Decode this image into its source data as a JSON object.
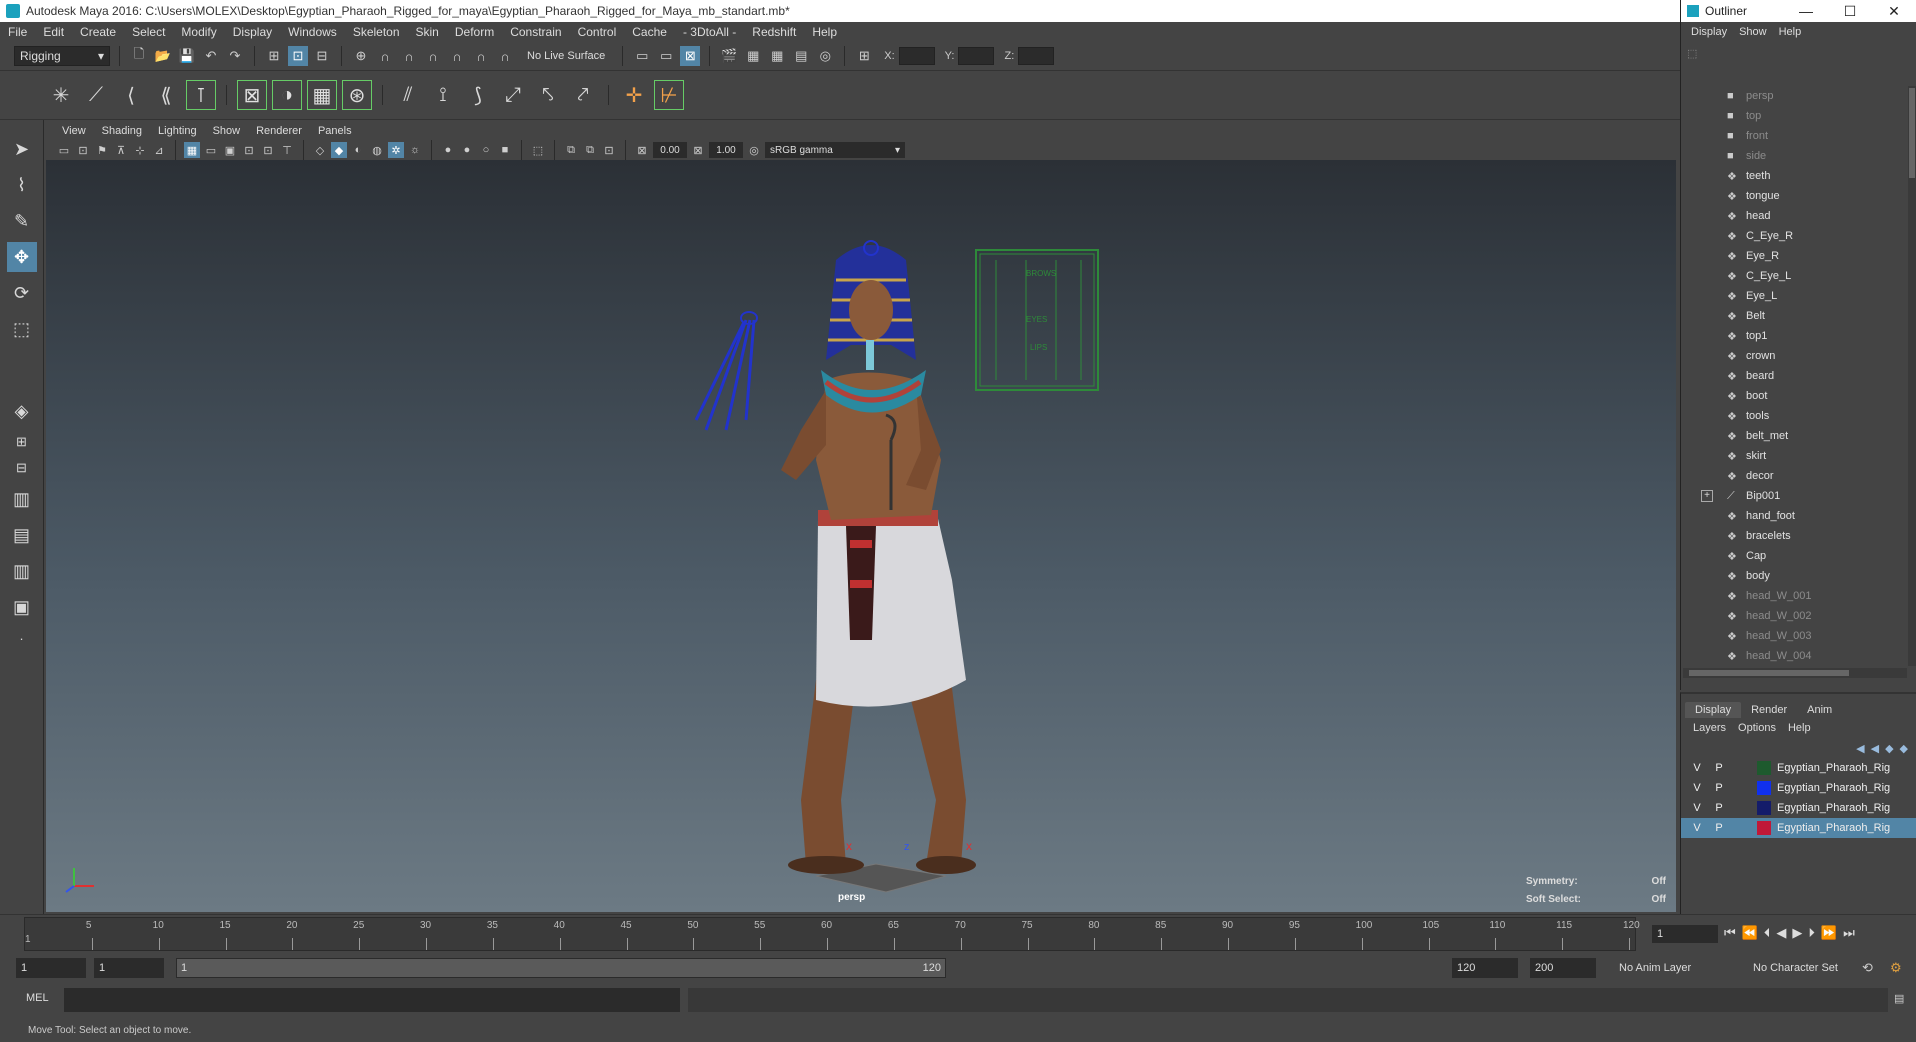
{
  "window": {
    "title": "Autodesk Maya 2016: C:\\Users\\MOLEX\\Desktop\\Egyptian_Pharaoh_Rigged_for_maya\\Egyptian_Pharaoh_Rigged_for_Maya_mb_standart.mb*"
  },
  "menubar": [
    "File",
    "Edit",
    "Create",
    "Select",
    "Modify",
    "Display",
    "Windows",
    "Skeleton",
    "Skin",
    "Deform",
    "Constrain",
    "Control",
    "Cache",
    "- 3DtoAll -",
    "Redshift",
    "Help"
  ],
  "statusline": {
    "menuset": "Rigging",
    "live_surface": "No Live Surface",
    "x_label": "X:",
    "y_label": "Y:",
    "z_label": "Z:"
  },
  "panel_menu": [
    "View",
    "Shading",
    "Lighting",
    "Show",
    "Renderer",
    "Panels"
  ],
  "panel_toolbar": {
    "exposure": "0.00",
    "gamma": "1.00",
    "color_space": "sRGB gamma"
  },
  "viewport": {
    "camera": "persp",
    "hud": {
      "symmetry_label": "Symmetry:",
      "symmetry_value": "Off",
      "soft_select_label": "Soft Select:",
      "soft_select_value": "Off"
    },
    "face_panel_labels": [
      "BROWS",
      "EYES",
      "LIPS"
    ],
    "axis_labels": {
      "x": "x",
      "z": "z"
    },
    "colors": {
      "skin": "#8a5a3a",
      "skirt": "#d8d8dc",
      "headdress_stripe": "#23309a",
      "gold": "#c8a44a",
      "face_panel": "#2e8a3a",
      "wire": "#2233cc",
      "locator": "#e03030"
    }
  },
  "outliner": {
    "title": "Outliner",
    "window_buttons": [
      "—",
      "☐",
      "✕"
    ],
    "menu": [
      "Display",
      "Show",
      "Help"
    ],
    "items": [
      {
        "label": "persp",
        "icon": "camera-icon",
        "dim": true
      },
      {
        "label": "top",
        "icon": "camera-icon",
        "dim": true
      },
      {
        "label": "front",
        "icon": "camera-icon",
        "dim": true
      },
      {
        "label": "side",
        "icon": "camera-icon",
        "dim": true
      },
      {
        "label": "teeth",
        "icon": "mesh-icon",
        "dim": false
      },
      {
        "label": "tongue",
        "icon": "mesh-icon",
        "dim": false
      },
      {
        "label": "head",
        "icon": "mesh-icon",
        "dim": false
      },
      {
        "label": "C_Eye_R",
        "icon": "mesh-icon",
        "dim": false
      },
      {
        "label": "Eye_R",
        "icon": "mesh-icon",
        "dim": false
      },
      {
        "label": "C_Eye_L",
        "icon": "mesh-icon",
        "dim": false
      },
      {
        "label": "Eye_L",
        "icon": "mesh-icon",
        "dim": false
      },
      {
        "label": "Belt",
        "icon": "mesh-icon",
        "dim": false
      },
      {
        "label": "top1",
        "icon": "mesh-icon",
        "dim": false
      },
      {
        "label": "crown",
        "icon": "mesh-icon",
        "dim": false
      },
      {
        "label": "beard",
        "icon": "mesh-icon",
        "dim": false
      },
      {
        "label": "boot",
        "icon": "mesh-icon",
        "dim": false
      },
      {
        "label": "tools",
        "icon": "mesh-icon",
        "dim": false
      },
      {
        "label": "belt_met",
        "icon": "mesh-icon",
        "dim": false
      },
      {
        "label": "skirt",
        "icon": "mesh-icon",
        "dim": false
      },
      {
        "label": "decor",
        "icon": "mesh-icon",
        "dim": false
      },
      {
        "label": "Bip001",
        "icon": "joint-icon",
        "dim": false,
        "expandable": true
      },
      {
        "label": "hand_foot",
        "icon": "mesh-icon",
        "dim": false
      },
      {
        "label": "bracelets",
        "icon": "mesh-icon",
        "dim": false
      },
      {
        "label": "Cap",
        "icon": "mesh-icon",
        "dim": false
      },
      {
        "label": "body",
        "icon": "mesh-icon",
        "dim": false
      },
      {
        "label": "head_W_001",
        "icon": "mesh-icon",
        "dim": true
      },
      {
        "label": "head_W_002",
        "icon": "mesh-icon",
        "dim": true
      },
      {
        "label": "head_W_003",
        "icon": "mesh-icon",
        "dim": true
      },
      {
        "label": "head_W_004",
        "icon": "mesh-icon",
        "dim": true
      }
    ]
  },
  "layers": {
    "tabs": [
      "Display",
      "Render",
      "Anim"
    ],
    "menu": [
      "Layers",
      "Options",
      "Help"
    ],
    "rows": [
      {
        "v": "V",
        "p": "P",
        "color": "#1e5a2e",
        "name": "Egyptian_Pharaoh_Rig",
        "selected": false
      },
      {
        "v": "V",
        "p": "P",
        "color": "#1030ee",
        "name": "Egyptian_Pharaoh_Rig",
        "selected": false
      },
      {
        "v": "V",
        "p": "P",
        "color": "#141c6a",
        "name": "Egyptian_Pharaoh_Rig",
        "selected": false
      },
      {
        "v": "V",
        "p": "P",
        "color": "#c01838",
        "name": "Egyptian_Pharaoh_Rig",
        "selected": true
      }
    ]
  },
  "timeline": {
    "ticks": [
      "5",
      "10",
      "15",
      "20",
      "25",
      "30",
      "35",
      "40",
      "45",
      "50",
      "55",
      "60",
      "65",
      "70",
      "75",
      "80",
      "85",
      "90",
      "95",
      "100",
      "105",
      "110",
      "115",
      "120"
    ],
    "current_frame": "1",
    "start_marker": "1"
  },
  "range": {
    "start": "1",
    "playback_start": "1",
    "bar_start": "1",
    "bar_end": "120",
    "playback_end": "120",
    "end": "200",
    "anim_layer": "No Anim Layer",
    "character_set": "No Character Set"
  },
  "cmdline": {
    "label": "MEL"
  },
  "help": {
    "text": "Move Tool: Select an object to move."
  }
}
